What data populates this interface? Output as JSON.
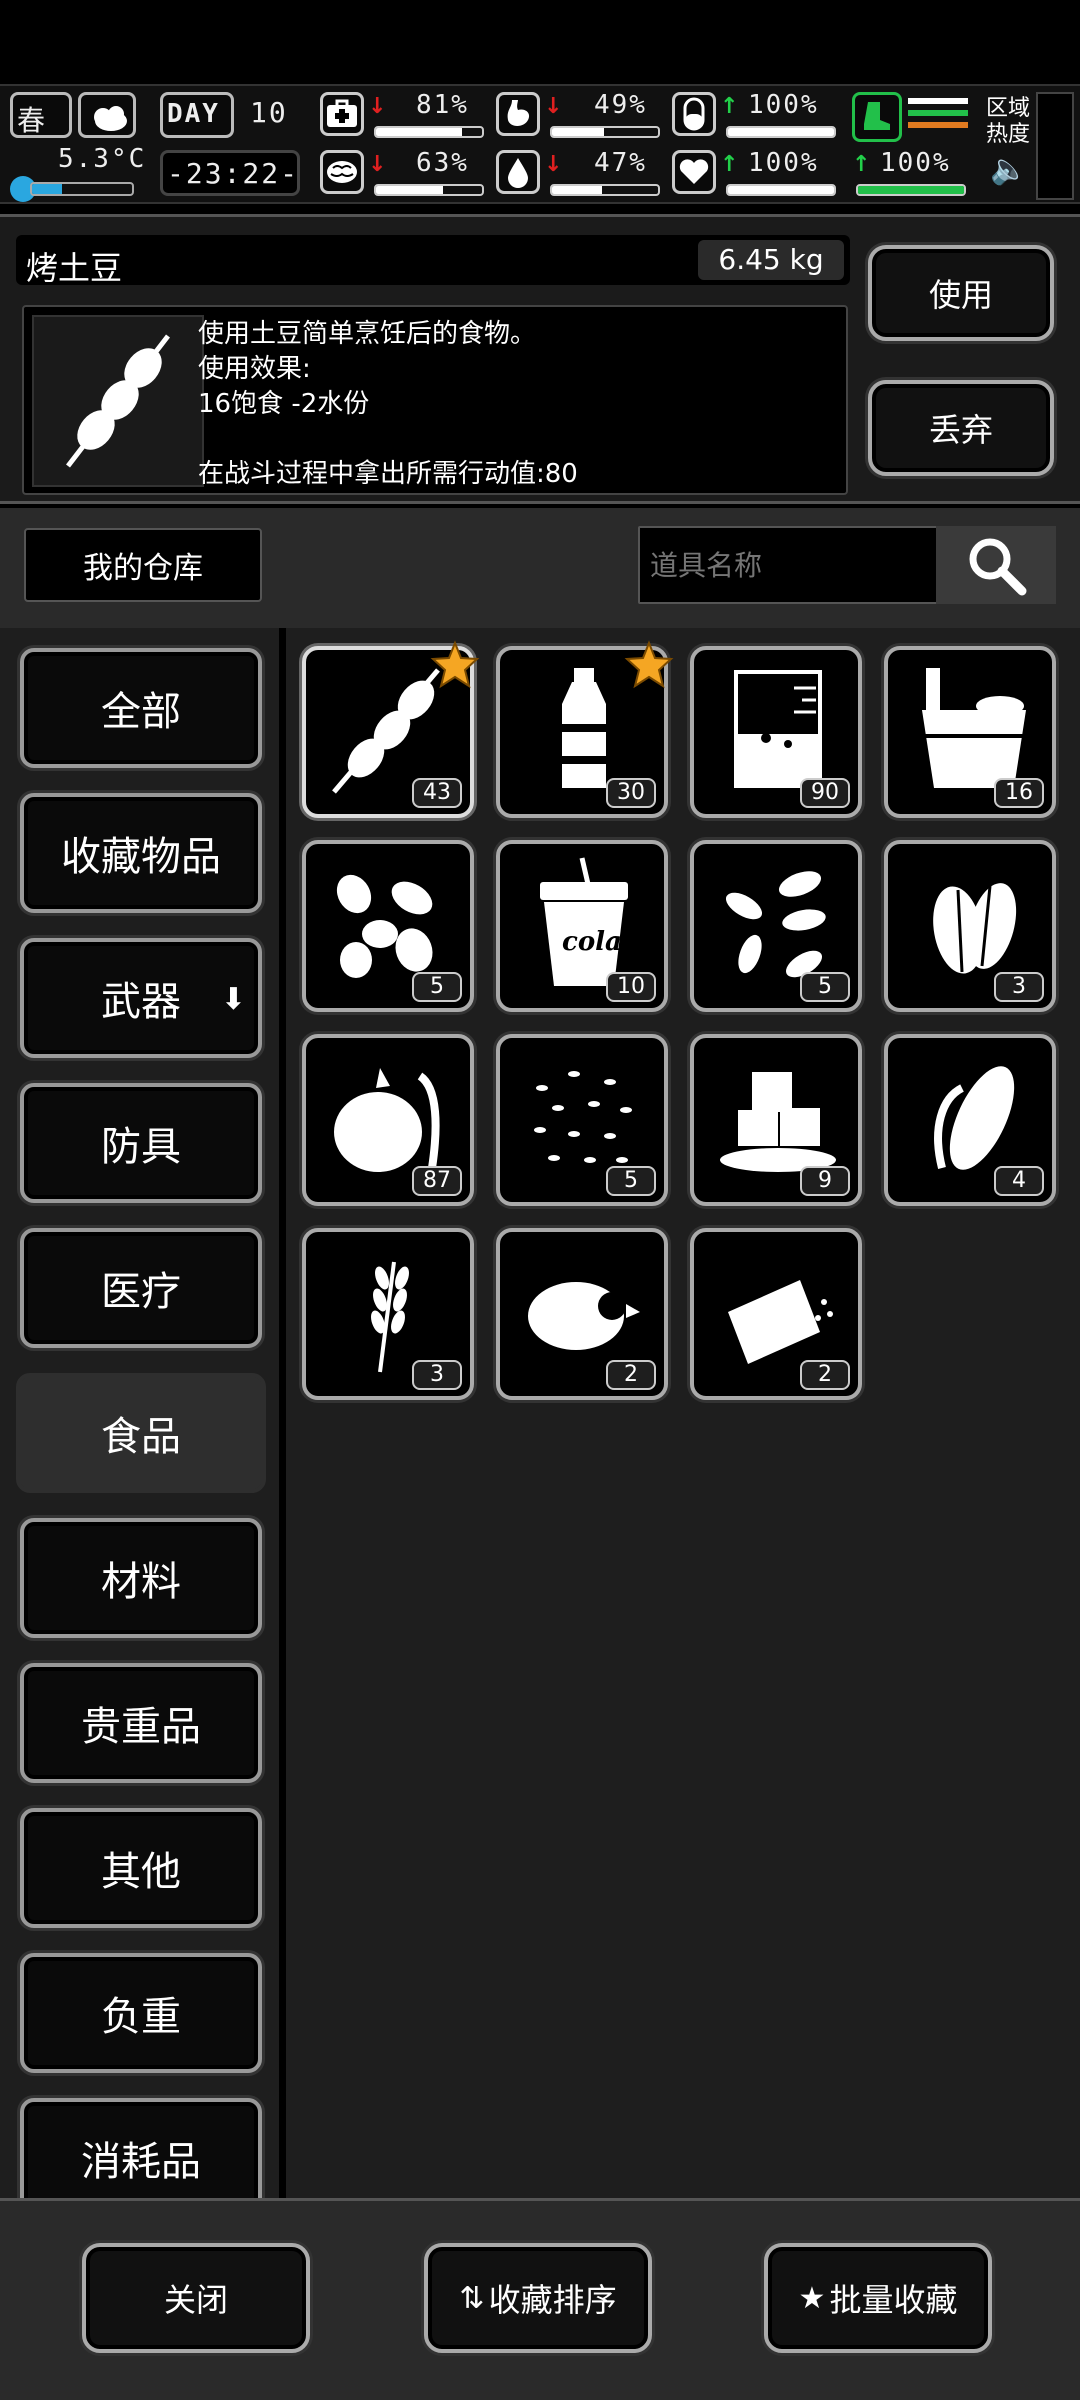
{
  "status": {
    "season": "春",
    "temperature": "5.3°C",
    "day_label": "DAY",
    "day": "10",
    "time": "-23:22-",
    "health_pct": "81%",
    "hunger_pct": "49%",
    "capsule_pct": "100%",
    "mental_pct": "63%",
    "water_pct": "47%",
    "heart_pct": "100%",
    "stamina_pct": "100%",
    "area_heat_label": "区域\n热度",
    "health_level": 0.81,
    "hunger_level": 0.49,
    "capsule_level": 1.0,
    "mental_level": 0.63,
    "water_level": 0.47,
    "heart_level": 1.0,
    "stamina_level": 1.0,
    "accent_green": "#22c04a",
    "accent_red": "#e02020",
    "accent_orange": "#e07a20"
  },
  "detail": {
    "name": "烤土豆",
    "weight": "6.45 kg",
    "description": "使用土豆简单烹饪后的食物。\n使用效果:\n16饱食 -2水份\n\n在战斗过程中拿出所需行动值:80",
    "use_label": "使用",
    "drop_label": "丢弃"
  },
  "warehouse": {
    "title": "我的仓库",
    "search_placeholder": "道具名称"
  },
  "categories": [
    {
      "label": "全部",
      "active": false
    },
    {
      "label": "收藏物品",
      "active": false
    },
    {
      "label": "武器",
      "active": false,
      "has_arrow": true
    },
    {
      "label": "防具",
      "active": false
    },
    {
      "label": "医疗",
      "active": false
    },
    {
      "label": "食品",
      "active": true
    },
    {
      "label": "材料",
      "active": false
    },
    {
      "label": "贵重品",
      "active": false
    },
    {
      "label": "其他",
      "active": false
    },
    {
      "label": "负重",
      "active": false
    },
    {
      "label": "消耗品",
      "active": false
    }
  ],
  "items": [
    {
      "icon": "roasted-potato-skewer-icon",
      "count": "43",
      "favorite": true,
      "selected": true
    },
    {
      "icon": "water-bottle-icon",
      "count": "30",
      "favorite": true
    },
    {
      "icon": "beaker-icon",
      "count": "90",
      "favorite": false
    },
    {
      "icon": "bucket-icon",
      "count": "16",
      "favorite": false
    },
    {
      "icon": "nuts-icon",
      "count": "5",
      "favorite": false
    },
    {
      "icon": "cola-cup-icon",
      "count": "10",
      "favorite": false,
      "label": "cola"
    },
    {
      "icon": "seeds-icon",
      "count": "5",
      "favorite": false
    },
    {
      "icon": "leaf-seeds-icon",
      "count": "3",
      "favorite": false
    },
    {
      "icon": "sweet-potato-icon",
      "count": "87",
      "favorite": false
    },
    {
      "icon": "grain-seeds-icon",
      "count": "5",
      "favorite": false
    },
    {
      "icon": "ice-cubes-icon",
      "count": "9",
      "favorite": false
    },
    {
      "icon": "corn-icon",
      "count": "4",
      "favorite": false
    },
    {
      "icon": "wheat-icon",
      "count": "3",
      "favorite": false
    },
    {
      "icon": "meat-icon",
      "count": "2",
      "favorite": false
    },
    {
      "icon": "bread-icon",
      "count": "2",
      "favorite": false
    }
  ],
  "footer": {
    "close_label": "关闭",
    "sort_label": "收藏排序",
    "batch_fav_label": "批量收藏"
  }
}
